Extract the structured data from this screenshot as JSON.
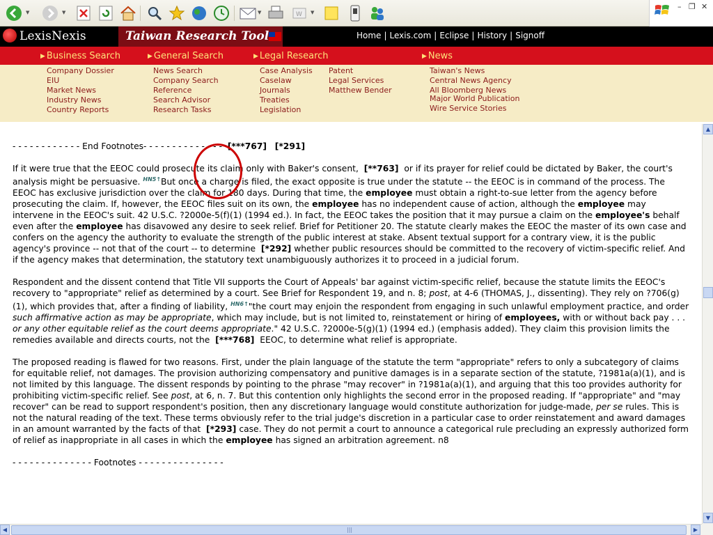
{
  "toolbar": {
    "icons": [
      "back-icon",
      "forward-icon",
      "stop-icon",
      "refresh-icon",
      "home-icon",
      "search-icon",
      "favorites-icon",
      "media-icon",
      "history-icon",
      "mail-icon",
      "print-icon",
      "edit-icon",
      "discuss-icon",
      "messenger-icon",
      "contacts-icon"
    ]
  },
  "header": {
    "logo": "LexisNexis",
    "title": "Taiwan Research Tools",
    "nav": [
      "Home",
      "Lexis.com",
      "Eclipse",
      "History",
      "Signoff"
    ]
  },
  "categories": [
    "Business Search",
    "General Search",
    "Legal Research",
    "News"
  ],
  "submenu": {
    "business": [
      "Company Dossier",
      "EIU",
      "Market News",
      "Industry News",
      "Country Reports"
    ],
    "general": [
      "News Search",
      "Company Search",
      "Reference",
      "Search Advisor",
      "Research Tasks"
    ],
    "legal_a": [
      "Case Analysis",
      "Caselaw",
      "Journals",
      "Treaties",
      "Legislation"
    ],
    "legal_b": [
      "Patent",
      "Legal Services",
      "Matthew Bender"
    ],
    "news": [
      "Taiwan's News",
      "Central News Agency",
      "All Bloomberg News",
      "Major World Publication",
      "Wire Service Stories"
    ]
  },
  "doc": {
    "end_footnotes_line": "- - - - - - - - - - - - End Footnotes- - - - - - - - - - - - - -",
    "page_767": "[***767]",
    "page_291": "[*291]",
    "p1_a": "If it were true that the EEOC could prosecute its claim only with Baker's consent,",
    "page_763": "[**763]",
    "p1_b": "or if its prayer for relief could be dictated by Baker, the court's analysis might be persuasive.",
    "hn5": "HN5",
    "p1_c": "But once a charge is filed, the exact opposite is true under the statute -- the EEOC is in command of the process. The EEOC has exclusive jurisdiction over the claim for 180 days. During that time, the",
    "employee": "employee",
    "p1_d": "must obtain a right-to-sue letter from the agency before prosecuting the claim. If, however, the EEOC files suit on its own, the",
    "p1_e": "has no independent cause of action, although the",
    "p1_f": "may intervene in the EEOC's suit. 42 U.S.C. ?2000e-5(f)(1) (1994 ed.). In fact, the EEOC takes the position that it may pursue a claim on the",
    "employees_poss": "employee's",
    "p1_g": "behalf even after the",
    "p1_h": "has disavowed any desire to seek relief. Brief for Petitioner 20. The statute clearly makes the EEOC the master of its own case and confers on the agency the authority to evaluate the strength of the public interest at stake. Absent textual support for a contrary view, it is the public agency's province -- not that of the court -- to determine",
    "page_292": "[*292]",
    "p1_i": "whether public resources should be committed to the recovery of victim-specific relief. And if the agency makes that determination, the statutory text unambiguously authorizes it to proceed in a judicial forum.",
    "p2_a": "Respondent and the dissent contend that Title VII supports the Court of Appeals' bar against victim-specific relief, because the statute limits the EEOC's recovery to \"appropriate\" relief as determined by a court. See Brief for Respondent 19, and n. 8;",
    "post": "post",
    "p2_b": ", at 4-6 (THOMAS, J., dissenting). They rely on ?706(g)(1), which provides that, after a finding of liability,",
    "hn6": "HN6",
    "p2_c": "\"the court may enjoin the respondent from engaging in such unlawful employment practice, and order",
    "p2_italic1": "such affirmative action as may be appropriate",
    "p2_d": ", which may include, but is not limited to, reinstatement or hiring of",
    "employees": "employees,",
    "p2_e": "with or without back pay . . .",
    "p2_italic2": "or any other equitable relief as the court deems appropriate",
    "p2_f": ".\" 42 U.S.C. ?2000e-5(g)(1) (1994 ed.) (emphasis added). They claim this provision limits the remedies available and directs courts, not the",
    "page_768": "[***768]",
    "p2_g": "EEOC, to determine what relief is appropriate.",
    "p3_a": "The proposed reading is flawed for two reasons. First, under the plain language of the statute the term \"appropriate\" refers to only a subcategory of claims for equitable relief, not damages. The provision authorizing compensatory and punitive damages is in a separate section of the statute, ?1981a(a)(1), and is not limited by this language. The dissent responds by pointing to the phrase \"may recover\" in ?1981a(a)(1), and arguing that this too provides authority for prohibiting victim-specific relief. See",
    "p3_b": ", at 6, n. 7. But this contention only highlights the second error in the proposed reading. If \"appropriate\" and \"may recover\" can be read to support respondent's position, then any discretionary language would constitute authorization for judge-made,",
    "per_se": "per se",
    "p3_c": "rules. This is not the natural reading of the text. These terms obviously refer to the trial judge's discretion in a particular case to order reinstatement and award damages in an amount warranted by the facts of that",
    "page_293": "[*293]",
    "p3_d": "case. They do not permit a court to announce a categorical rule precluding an expressly authorized form of relief as inappropriate in all cases in which the",
    "p3_e": "has signed an arbitration agreement. n8",
    "footnotes_line": "- - - - - - - - - - - - - - Footnotes - - - - - - - - - - - - - - -"
  }
}
